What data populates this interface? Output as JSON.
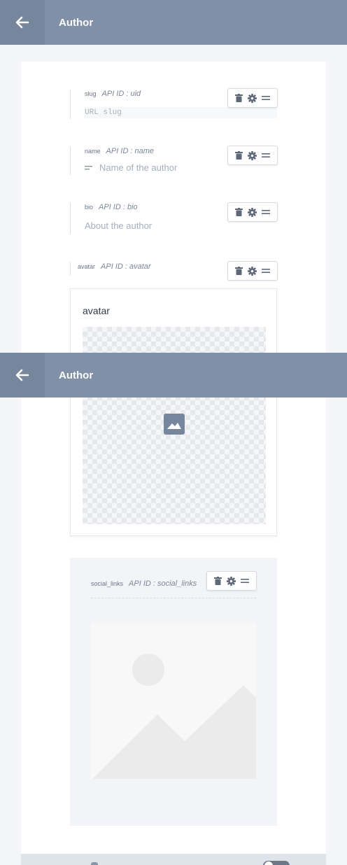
{
  "header": {
    "title": "Author"
  },
  "fields": {
    "slug": {
      "name": "slug",
      "api_id": "API ID : uid",
      "placeholder": "URL slug"
    },
    "name": {
      "name": "name",
      "api_id": "API ID : name",
      "placeholder": "Name of the author"
    },
    "bio": {
      "name": "bio",
      "api_id": "API ID : bio",
      "placeholder": "About the author"
    },
    "avatar": {
      "name": "avatar",
      "api_id": "API ID : avatar",
      "card_title": "avatar"
    },
    "social_links": {
      "name": "social_links",
      "api_id": "API ID : social_links"
    }
  },
  "icons": {
    "back": "arrow-left-icon",
    "delete": "trash-icon",
    "settings": "gear-icon",
    "drag": "drag-handle-icon",
    "text": "text-lines-icon",
    "image": "image-icon"
  },
  "colors": {
    "header": "#8090a6",
    "header_back": "#75869d",
    "accent": "#6b7687"
  }
}
